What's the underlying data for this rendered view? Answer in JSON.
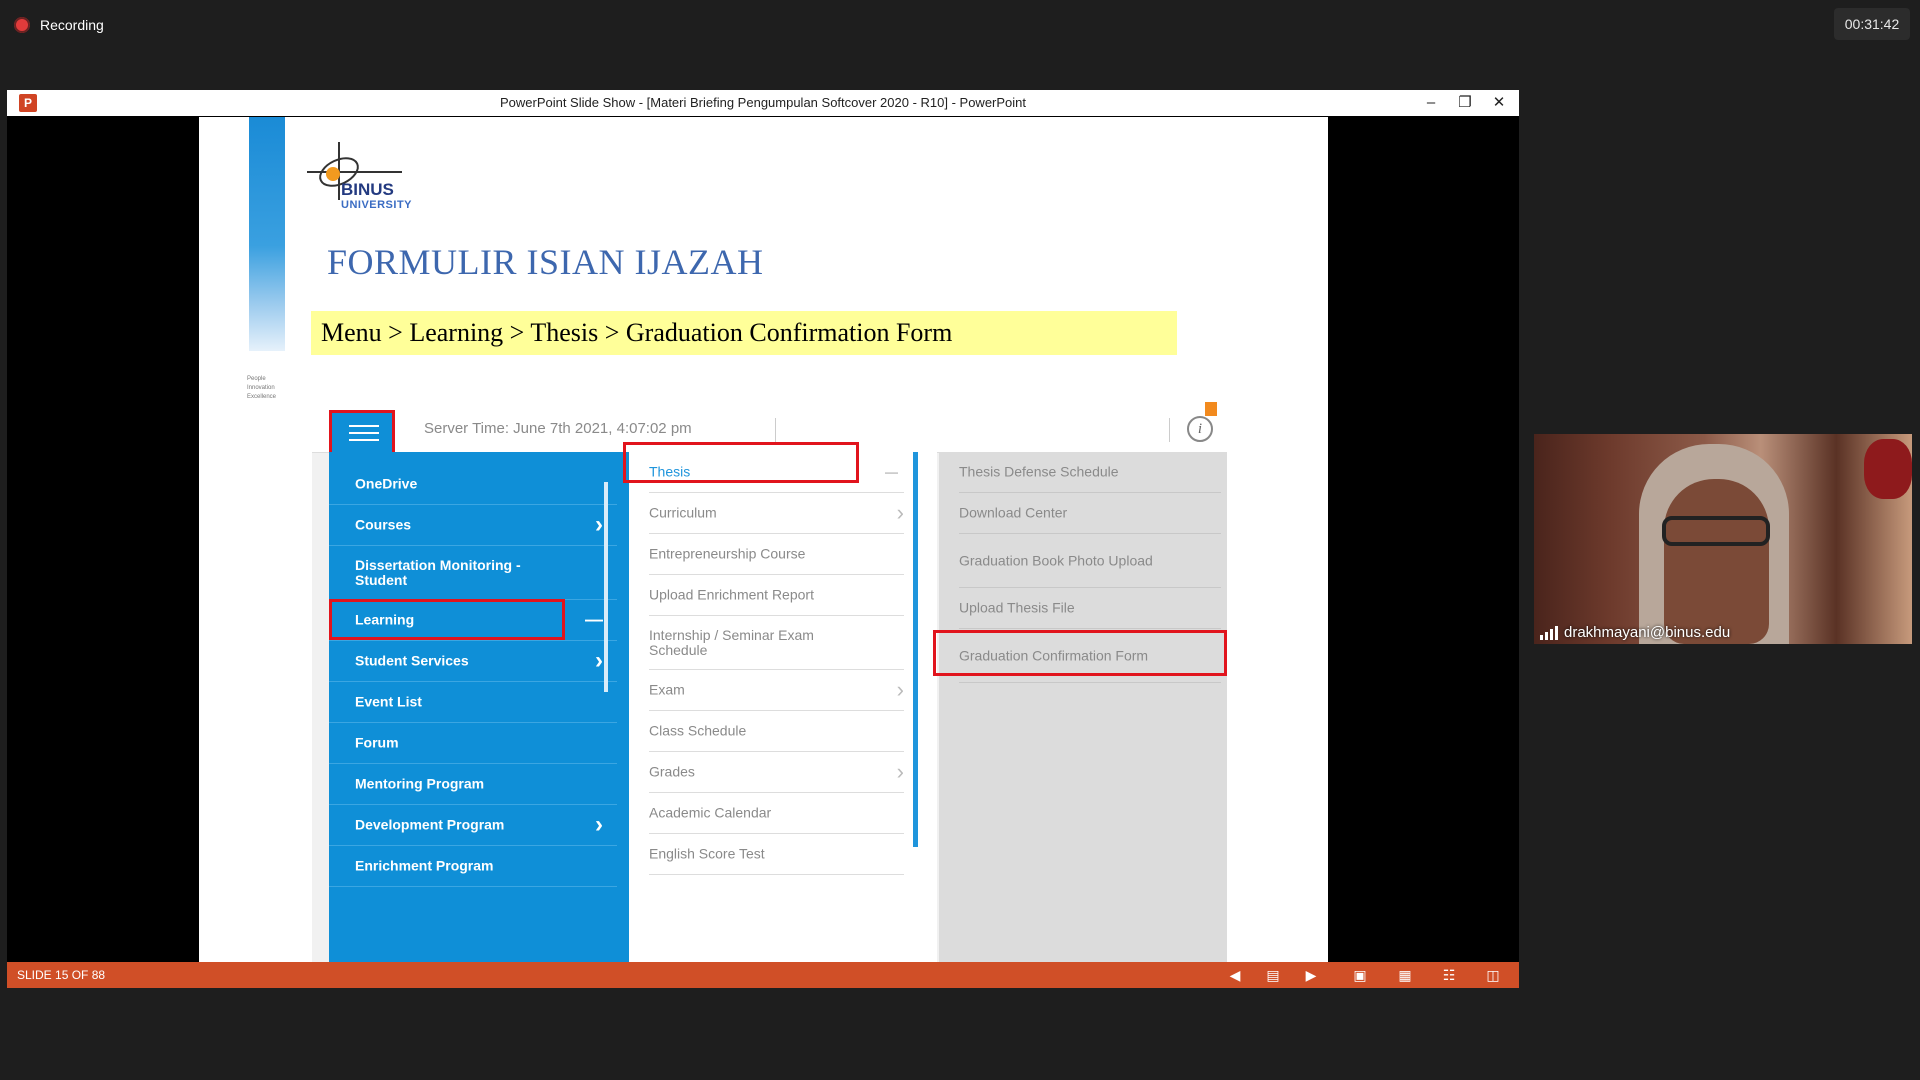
{
  "recording": {
    "label": "Recording"
  },
  "timer": {
    "value": "00:31:42"
  },
  "window": {
    "title": "PowerPoint Slide Show - [Materi Briefing Pengumpulan Softcover 2020 - R10] - PowerPoint",
    "app_icon": "P"
  },
  "slide": {
    "logo_name": "BINUS",
    "logo_sub": "UNIVERSITY",
    "tagline": [
      "People",
      "Innovation",
      "Excellence"
    ],
    "title": "FORMULIR ISIAN IJAZAH",
    "nav_path": "Menu > Learning > Thesis > Graduation Confirmation Form",
    "screenshot": {
      "server_time": "Server Time: June 7th 2021, 4:07:02 pm",
      "menu1": [
        {
          "label": "OneDrive"
        },
        {
          "label": "Courses"
        },
        {
          "label": "Dissertation Monitoring - Student"
        },
        {
          "label": "Learning"
        },
        {
          "label": "Student Services"
        },
        {
          "label": "Event List"
        },
        {
          "label": "Forum"
        },
        {
          "label": "Mentoring Program"
        },
        {
          "label": "Development Program"
        },
        {
          "label": "Enrichment Program"
        }
      ],
      "menu2": [
        {
          "label": "Thesis"
        },
        {
          "label": "Curriculum"
        },
        {
          "label": "Entrepreneurship Course"
        },
        {
          "label": "Upload Enrichment Report"
        },
        {
          "label": "Internship / Seminar Exam Schedule"
        },
        {
          "label": "Exam"
        },
        {
          "label": "Class Schedule"
        },
        {
          "label": "Grades"
        },
        {
          "label": "Academic Calendar"
        },
        {
          "label": "English Score Test"
        }
      ],
      "menu3": [
        {
          "label": "Thesis Defense Schedule"
        },
        {
          "label": "Download Center"
        },
        {
          "label": "Graduation Book Photo Upload"
        },
        {
          "label": "Upload Thesis File"
        },
        {
          "label": "Graduation Confirmation Form"
        }
      ]
    }
  },
  "statusbar": {
    "slide_count": "SLIDE 15 OF 88"
  },
  "webcam": {
    "participant": "drakhmayani@binus.edu"
  },
  "colors": {
    "accent_red": "#e1141d",
    "binus_blue": "#0f8fd7",
    "ppt_orange": "#d04f27",
    "highlight_yellow": "#ffff99"
  }
}
